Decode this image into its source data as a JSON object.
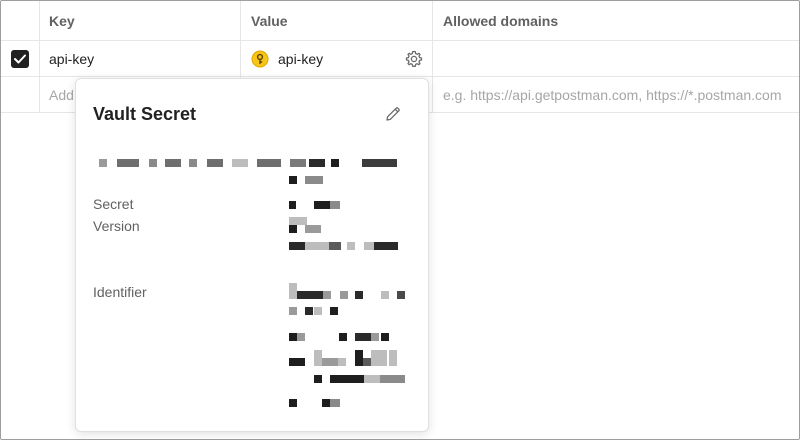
{
  "table": {
    "headers": {
      "key": "Key",
      "value": "Value",
      "allowed_domains": "Allowed domains"
    },
    "rows": [
      {
        "checked": true,
        "key": "api-key",
        "value": "api-key",
        "value_icon": "vault-key-icon",
        "value_action_icon": "gear-icon"
      }
    ],
    "new_row": {
      "key_placeholder": "Add",
      "domains_placeholder": "e.g. https://api.getpostman.com, https://*.postman.com"
    }
  },
  "popover": {
    "title": "Vault Secret",
    "edit_icon": "pencil-icon",
    "fields": {
      "secret_label": "Secret",
      "version_label": "Version",
      "identifier_label": "Identifier"
    }
  },
  "colors": {
    "checkbox": "#212121",
    "vault_icon_fill": "#f5c518",
    "text_muted": "#616161",
    "placeholder": "#a6a6a6"
  }
}
